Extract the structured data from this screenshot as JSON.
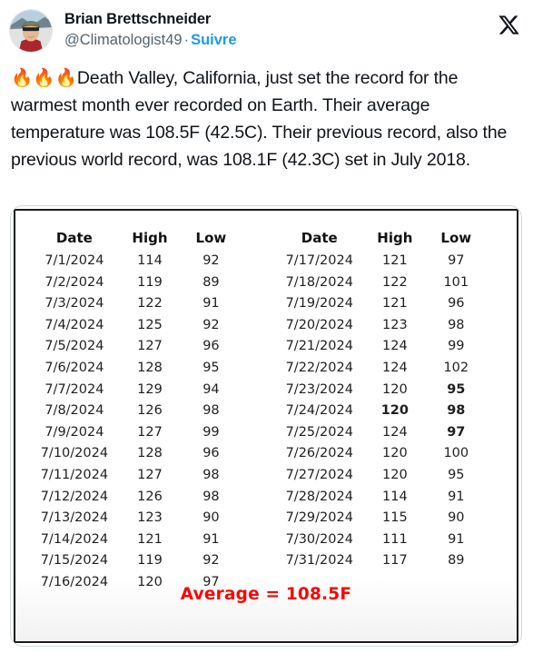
{
  "post": {
    "display_name": "Brian Brettschneider",
    "handle": "@Climatologist49",
    "separator": "·",
    "follow_label": "Suivre",
    "x_logo_name": "x-logo",
    "avatar_alt": "profile-photo",
    "emoji_prefix": "🔥🔥🔥",
    "text": "Death Valley, California, just set the record for the warmest month ever recorded on Earth. Their average temperature was 108.5F (42.5C). Their previous record, also the previous world record, was 108.1F (42.3C) set in July 2018."
  },
  "colors": {
    "accent_blue": "#1d9bf0",
    "text_primary": "#0f1419",
    "text_secondary": "#536471",
    "highlight_red": "#ff0000",
    "card_border": "#cfd9de",
    "table_border": "#1a1a1a"
  },
  "table": {
    "headers": [
      "Date",
      "High",
      "Low",
      "Date",
      "High",
      "Low"
    ],
    "footer": "Average = 108.5F",
    "rows": [
      {
        "date_l": "7/1/2024",
        "high_l": "114",
        "low_l": "92",
        "date_r": "7/17/2024",
        "high_r": "121",
        "low_r": "97",
        "high_r_hot": false,
        "low_r_hot": false
      },
      {
        "date_l": "7/2/2024",
        "high_l": "119",
        "low_l": "89",
        "date_r": "7/18/2024",
        "high_r": "122",
        "low_r": "101",
        "high_r_hot": false,
        "low_r_hot": false
      },
      {
        "date_l": "7/3/2024",
        "high_l": "122",
        "low_l": "91",
        "date_r": "7/19/2024",
        "high_r": "121",
        "low_r": "96",
        "high_r_hot": false,
        "low_r_hot": false
      },
      {
        "date_l": "7/4/2024",
        "high_l": "125",
        "low_l": "92",
        "date_r": "7/20/2024",
        "high_r": "123",
        "low_r": "98",
        "high_r_hot": false,
        "low_r_hot": false
      },
      {
        "date_l": "7/5/2024",
        "high_l": "127",
        "low_l": "96",
        "date_r": "7/21/2024",
        "high_r": "124",
        "low_r": "99",
        "high_r_hot": false,
        "low_r_hot": false
      },
      {
        "date_l": "7/6/2024",
        "high_l": "128",
        "low_l": "95",
        "date_r": "7/22/2024",
        "high_r": "124",
        "low_r": "102",
        "high_r_hot": false,
        "low_r_hot": false
      },
      {
        "date_l": "7/7/2024",
        "high_l": "129",
        "low_l": "94",
        "date_r": "7/23/2024",
        "high_r": "120",
        "low_r": "95",
        "high_r_hot": false,
        "low_r_hot": true
      },
      {
        "date_l": "7/8/2024",
        "high_l": "126",
        "low_l": "98",
        "date_r": "7/24/2024",
        "high_r": "120",
        "low_r": "98",
        "high_r_hot": true,
        "low_r_hot": true
      },
      {
        "date_l": "7/9/2024",
        "high_l": "127",
        "low_l": "99",
        "date_r": "7/25/2024",
        "high_r": "124",
        "low_r": "97",
        "high_r_hot": false,
        "low_r_hot": true
      },
      {
        "date_l": "7/10/2024",
        "high_l": "128",
        "low_l": "96",
        "date_r": "7/26/2024",
        "high_r": "120",
        "low_r": "100",
        "high_r_hot": false,
        "low_r_hot": false
      },
      {
        "date_l": "7/11/2024",
        "high_l": "127",
        "low_l": "98",
        "date_r": "7/27/2024",
        "high_r": "120",
        "low_r": "95",
        "high_r_hot": false,
        "low_r_hot": false
      },
      {
        "date_l": "7/12/2024",
        "high_l": "126",
        "low_l": "98",
        "date_r": "7/28/2024",
        "high_r": "114",
        "low_r": "91",
        "high_r_hot": false,
        "low_r_hot": false
      },
      {
        "date_l": "7/13/2024",
        "high_l": "123",
        "low_l": "90",
        "date_r": "7/29/2024",
        "high_r": "115",
        "low_r": "90",
        "high_r_hot": false,
        "low_r_hot": false
      },
      {
        "date_l": "7/14/2024",
        "high_l": "121",
        "low_l": "91",
        "date_r": "7/30/2024",
        "high_r": "111",
        "low_r": "91",
        "high_r_hot": false,
        "low_r_hot": false
      },
      {
        "date_l": "7/15/2024",
        "high_l": "119",
        "low_l": "92",
        "date_r": "7/31/2024",
        "high_r": "117",
        "low_r": "89",
        "high_r_hot": false,
        "low_r_hot": false
      },
      {
        "date_l": "7/16/2024",
        "high_l": "120",
        "low_l": "97",
        "date_r": "",
        "high_r": "",
        "low_r": "",
        "high_r_hot": false,
        "low_r_hot": false
      }
    ]
  }
}
